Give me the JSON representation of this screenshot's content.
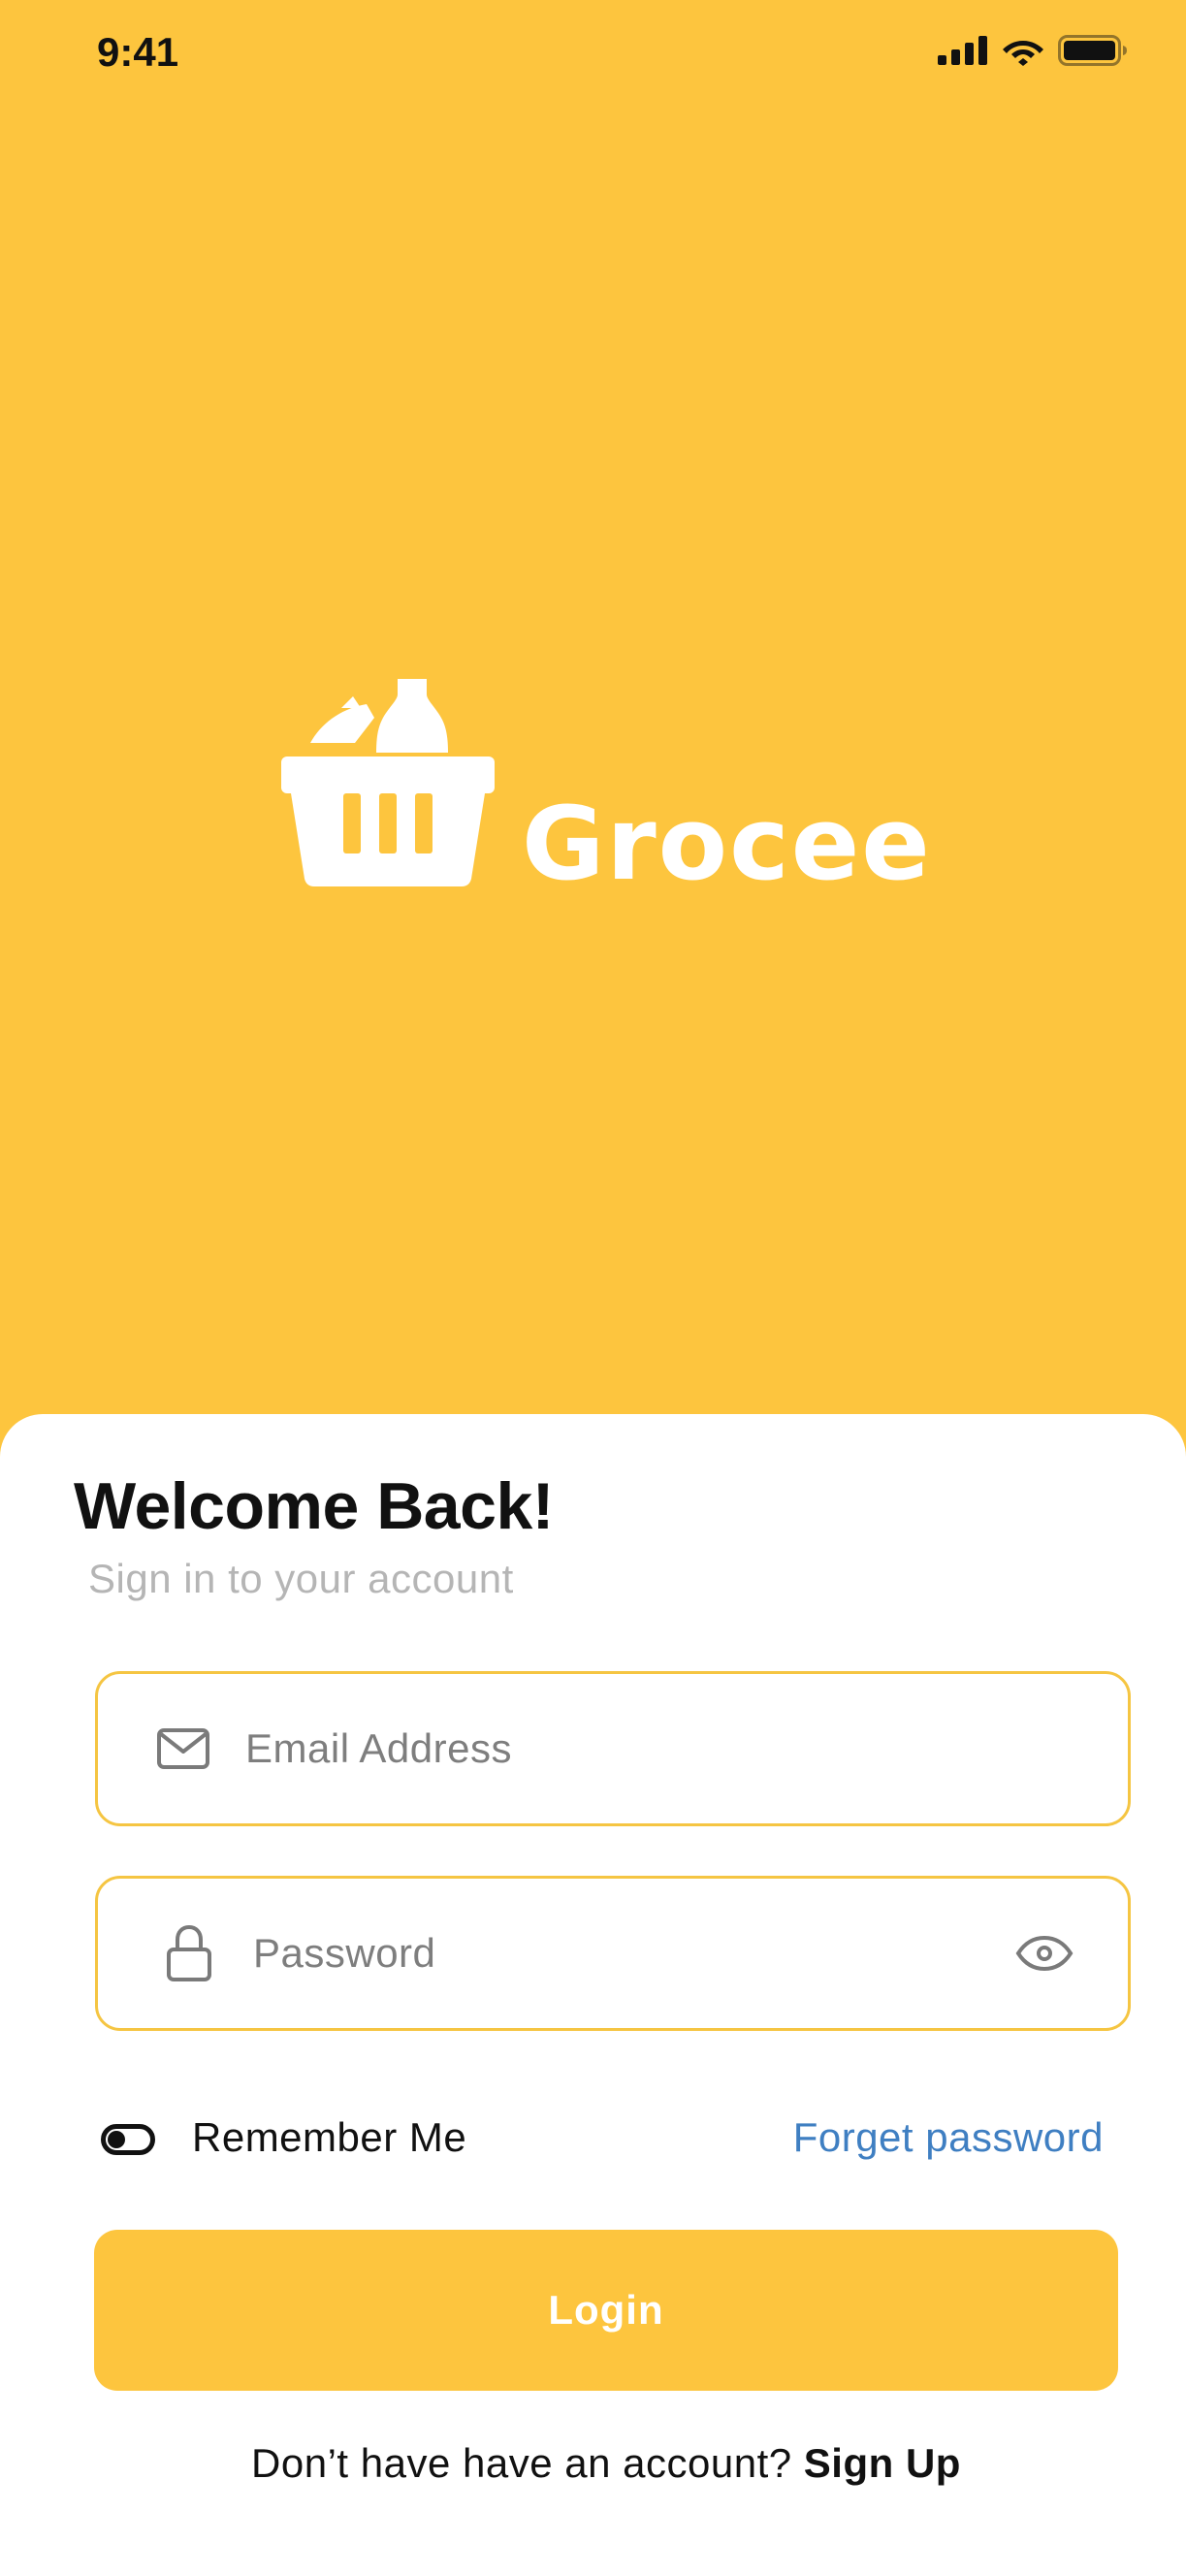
{
  "status_bar": {
    "time": "9:41",
    "icons": [
      "cellular-signal-icon",
      "wifi-icon",
      "battery-icon"
    ]
  },
  "hero": {
    "brand_name": "Grocee",
    "logo_icon": "grocery-basket-icon"
  },
  "login": {
    "title": "Welcome Back!",
    "subtitle": "Sign in to your account",
    "email": {
      "placeholder": "Email Address",
      "value": "",
      "icon": "mail-icon"
    },
    "password": {
      "placeholder": "Password",
      "value": "",
      "icon": "lock-icon",
      "toggle_icon": "eye-icon"
    },
    "remember_me_label": "Remember Me",
    "remember_me_icon": "toggle-icon",
    "forgot_password_label": "Forget password",
    "login_button_label": "Login",
    "signup_prompt": "Don’t have have an account?",
    "signup_link": "Sign Up"
  },
  "colors": {
    "brand_yellow": "#fdc53e",
    "field_border": "#f5c542",
    "link_blue": "#3f7fc2",
    "subtitle_gray": "#b5b5b5",
    "placeholder_gray": "#7e7e7e"
  }
}
